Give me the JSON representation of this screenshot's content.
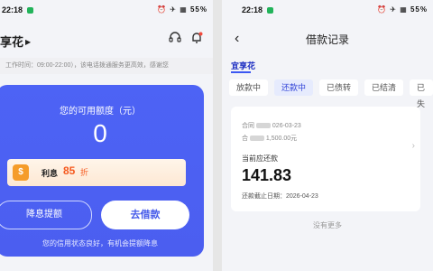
{
  "status": {
    "time": "22:18",
    "right_icons": "⏰ ✈ ▦ 55%"
  },
  "left": {
    "brand": "享花",
    "notice": "工作时间：09:00-22:00），该电话拨通服务更高效，感谢您",
    "card": {
      "label": "您的可用额度（元）",
      "amount": "0",
      "interest_label": "利息",
      "interest_discount": "85",
      "interest_suffix": "折",
      "btn_raise": "降息提额",
      "btn_borrow": "去借款",
      "footer": "您的信用状态良好，有机会提额降息"
    }
  },
  "right": {
    "title": "借款记录",
    "subbrand": "宜享花",
    "tabs": [
      "放款中",
      "还款中",
      "已债转",
      "已结清",
      "已失"
    ],
    "active_tab": "还款中",
    "record": {
      "contract_label": "合同",
      "contract_date": "026-03-23",
      "principal_label": "合",
      "principal_value": "1,500.00元",
      "due_label": "当前应还款",
      "due_amount": "141.83",
      "deadline": "还款截止日期：2026-04-23"
    },
    "more": "没有更多"
  },
  "colors": {
    "accent": "#4b5ef0",
    "interest": "#f55a1f"
  }
}
